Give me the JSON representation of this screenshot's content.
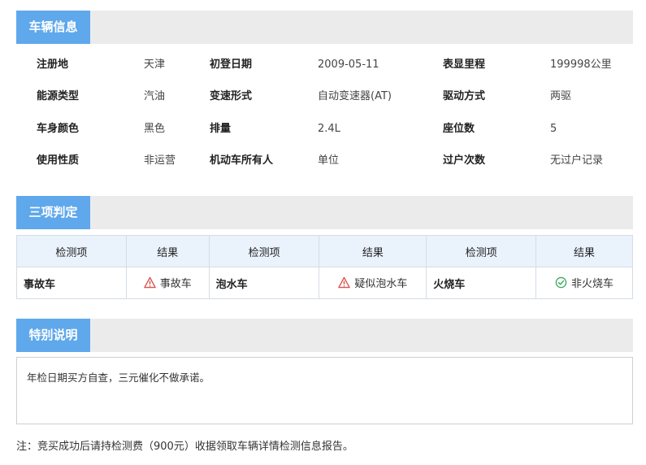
{
  "sections": {
    "vehicle_info": "车辆信息",
    "three_judgments": "三项判定",
    "special_notes": "特别说明"
  },
  "vehicle_info": {
    "rows": [
      [
        {
          "label": "注册地",
          "value": "天津"
        },
        {
          "label": "初登日期",
          "value": "2009-05-11"
        },
        {
          "label": "表显里程",
          "value": "199998公里"
        }
      ],
      [
        {
          "label": "能源类型",
          "value": "汽油"
        },
        {
          "label": "变速形式",
          "value": "自动变速器(AT)"
        },
        {
          "label": "驱动方式",
          "value": "两驱"
        }
      ],
      [
        {
          "label": "车身颜色",
          "value": "黑色"
        },
        {
          "label": "排量",
          "value": "2.4L"
        },
        {
          "label": "座位数",
          "value": "5"
        }
      ],
      [
        {
          "label": "使用性质",
          "value": "非运营"
        },
        {
          "label": "机动车所有人",
          "value": "单位"
        },
        {
          "label": "过户次数",
          "value": "无过户记录"
        }
      ]
    ]
  },
  "judgment_table": {
    "headers": [
      "检测项",
      "结果",
      "检测项",
      "结果",
      "检测项",
      "结果"
    ],
    "items": [
      {
        "name": "事故车",
        "result": "事故车",
        "status": "warning",
        "icon": "warning-triangle-icon",
        "color": "#d9534f"
      },
      {
        "name": "泡水车",
        "result": "疑似泡水车",
        "status": "warning",
        "icon": "warning-triangle-icon",
        "color": "#d9534f"
      },
      {
        "name": "火烧车",
        "result": "非火烧车",
        "status": "ok",
        "icon": "check-circle-icon",
        "color": "#3aa55a"
      }
    ]
  },
  "special_notes": {
    "text": "年检日期买方自查，三元催化不做承诺。"
  },
  "footnote": "注：竞买成功后请持检测费（900元）收据领取车辆详情检测信息报告。",
  "colors": {
    "tab_blue": "#5fa8ec",
    "header_gray": "#ebebeb",
    "table_header_bg": "#eaf3fc"
  }
}
